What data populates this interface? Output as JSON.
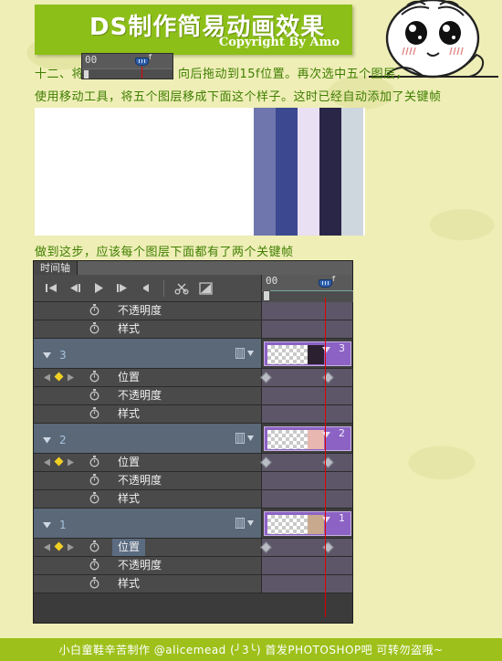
{
  "banner": {
    "title": "DS制作简易动画效果",
    "copyright": "Copyright By Amo"
  },
  "body": {
    "line1_before": "十二、将",
    "line1_after": "向后拖动到15f位置。再次选中五个图层，",
    "line2": "使用移动工具，将五个图层移成下面这个样子。这时已经自动添加了关键帧",
    "line3": "做到这步，应该每个图层下面都有了两个关键帧"
  },
  "photostrip": {
    "swatch_colors": [
      "#6f76ad",
      "#3c4890",
      "#eae0f3",
      "#2a2647",
      "#ced6de"
    ]
  },
  "inline_widget": {
    "frame_label": "00",
    "playhead_unit": "f"
  },
  "timeline": {
    "tab_label": "时间轴",
    "ruler": {
      "frame_label": "00",
      "playhead_unit": "f"
    },
    "toolbar": [
      {
        "name": "go-to-first-frame-icon",
        "label": "转到第一帧"
      },
      {
        "name": "previous-frame-icon",
        "label": "上一帧"
      },
      {
        "name": "play-icon",
        "label": "播放"
      },
      {
        "name": "next-frame-icon",
        "label": "下一帧"
      },
      {
        "name": "audio-icon",
        "label": "音频"
      },
      {
        "name": "scissors-icon",
        "label": "拆分剪辑"
      },
      {
        "name": "transition-icon",
        "label": "过渡效果"
      }
    ],
    "rows": [
      {
        "type": "prop",
        "label": "不透明度",
        "has_kfnav": false,
        "selected": false,
        "keyframes": []
      },
      {
        "type": "prop",
        "label": "样式",
        "has_kfnav": false,
        "selected": false,
        "keyframes": []
      },
      {
        "type": "layer",
        "label": "3",
        "clip_number": "3",
        "frag_color": "#2b2030"
      },
      {
        "type": "prop",
        "label": "位置",
        "has_kfnav": true,
        "selected": false,
        "keyframes": [
          0,
          68
        ]
      },
      {
        "type": "prop",
        "label": "不透明度",
        "has_kfnav": false,
        "selected": false,
        "keyframes": []
      },
      {
        "type": "prop",
        "label": "样式",
        "has_kfnav": false,
        "selected": false,
        "keyframes": []
      },
      {
        "type": "layer",
        "label": "2",
        "clip_number": "2",
        "frag_color": "#e8b7b0"
      },
      {
        "type": "prop",
        "label": "位置",
        "has_kfnav": true,
        "selected": false,
        "keyframes": [
          0,
          68
        ]
      },
      {
        "type": "prop",
        "label": "不透明度",
        "has_kfnav": false,
        "selected": false,
        "keyframes": []
      },
      {
        "type": "prop",
        "label": "样式",
        "has_kfnav": false,
        "selected": false,
        "keyframes": []
      },
      {
        "type": "layer",
        "label": "1",
        "clip_number": "1",
        "frag_color": "#c9a98e"
      },
      {
        "type": "prop",
        "label": "位置",
        "has_kfnav": true,
        "selected": true,
        "keyframes": [
          0,
          68
        ]
      },
      {
        "type": "prop",
        "label": "不透明度",
        "has_kfnav": false,
        "selected": false,
        "keyframes": []
      },
      {
        "type": "prop",
        "label": "样式",
        "has_kfnav": false,
        "selected": false,
        "keyframes": []
      }
    ]
  },
  "footer": {
    "text": "小白童鞋辛苦制作 @alicemead (╯3╰) 首发PHOTOSHOP吧  可转勿盗哦~"
  },
  "colors": {
    "banner_green": "#8cbf18",
    "footer_green": "#9dc11a",
    "page_bg": "#eeeeb6",
    "text_green": "#3f7e00",
    "playhead_red": "#e00000",
    "clip_purple": "#8c63c4"
  }
}
